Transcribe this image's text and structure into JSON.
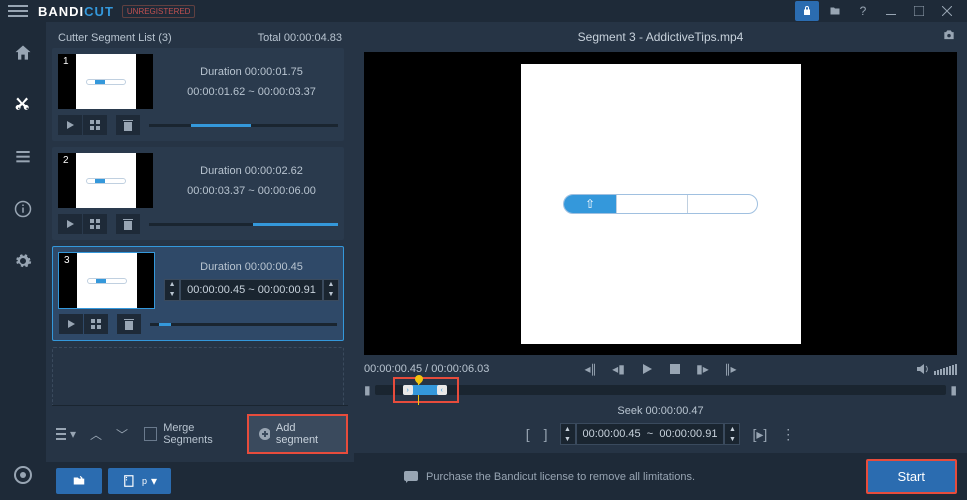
{
  "app": {
    "nameA": "BANDI",
    "nameB": "CUT",
    "unreg": "UNREGISTERED"
  },
  "segHeader": {
    "title": "Cutter Segment List (3)",
    "total": "Total 00:00:04.83"
  },
  "segments": [
    {
      "num": "1",
      "duration": "Duration 00:00:01.75",
      "range": "00:00:01.62 ~ 00:00:03.37"
    },
    {
      "num": "2",
      "duration": "Duration 00:00:02.62",
      "range": "00:00:03.37 ~ 00:00:06.00"
    },
    {
      "num": "3",
      "duration": "Duration 00:00:00.45",
      "start": "00:00:00.45",
      "sep": "~",
      "end": "00:00:00.91"
    }
  ],
  "leftFooter": {
    "merge": "Merge Segments",
    "add": "Add segment"
  },
  "preview": {
    "title": "Segment 3 - AddictiveTips.mp4"
  },
  "playback": {
    "pos": "00:00:00.45 / 00:00:06.03"
  },
  "seek": {
    "label": "Seek 00:00:00.47",
    "start": "00:00:00.45",
    "sep": "~",
    "end": "00:00:00.91"
  },
  "bottom": {
    "purchase": "Purchase the Bandicut license to remove all limitations.",
    "start": "Start"
  }
}
